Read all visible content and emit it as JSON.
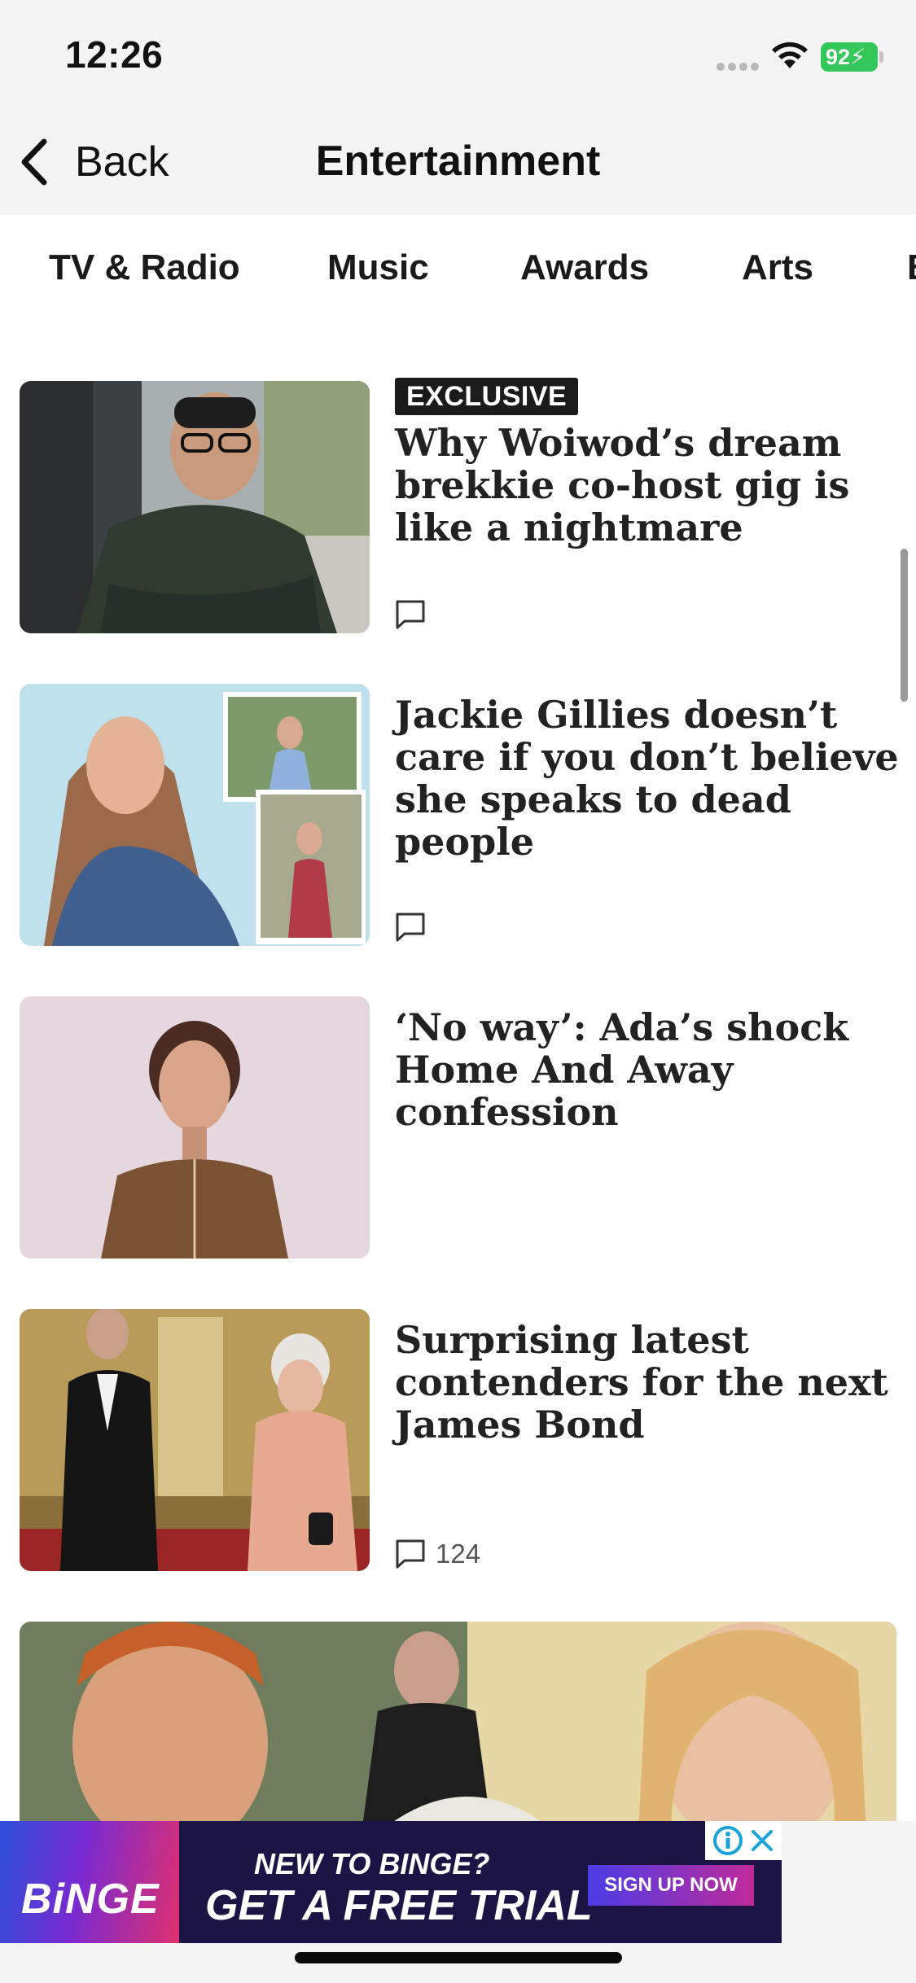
{
  "status_bar": {
    "time": "12:26",
    "battery": "92"
  },
  "nav": {
    "back_label": "Back",
    "title": "Entertainment"
  },
  "tabs": [
    "TV & Radio",
    "Music",
    "Awards",
    "Arts",
    "B"
  ],
  "articles": [
    {
      "badge": "EXCLUSIVE",
      "headline": "Why Woiwod’s dream brekkie co-host gig is like a nightmare",
      "comment_count": ""
    },
    {
      "headline": "Jackie Gillies doesn’t care if you don’t believe she speaks to dead people",
      "comment_count": ""
    },
    {
      "headline": "‘No way’: Ada’s shock Home And Away confession"
    },
    {
      "headline": "Surprising latest contenders for the next James Bond",
      "comment_count": "124"
    }
  ],
  "ad": {
    "brand": "BiNGE",
    "line1": "NEW TO BINGE?",
    "line2": "GET A FREE TRIAL",
    "cta": "SIGN UP NOW"
  },
  "colors": {
    "battery": "#34c759",
    "ad_background": "#1b1445",
    "badge": "#1b1b1b"
  }
}
